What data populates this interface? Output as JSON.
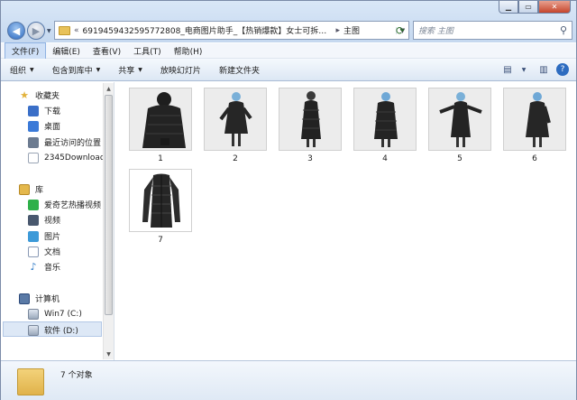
{
  "window": {
    "path_prefix": "«",
    "path_main": "6919459432595772808_电商图片助手_【热销爆款】女士可拆…",
    "path_last": "主图",
    "path_separator": "▸",
    "search_placeholder": "搜索 主图"
  },
  "menu": [
    "文件(F)",
    "编辑(E)",
    "查看(V)",
    "工具(T)",
    "帮助(H)"
  ],
  "toolbar": {
    "organize": "组织",
    "include_library": "包含到库中",
    "share": "共享",
    "slideshow": "放映幻灯片",
    "new_folder": "新建文件夹"
  },
  "sidebar": {
    "favorites": "收藏夹",
    "downloads": "下载",
    "desktop": "桌面",
    "recent": "最近访问的位置",
    "downloads2345": "2345Downloads",
    "libraries": "库",
    "iqiyi": "爱奇艺热播视频",
    "video": "视频",
    "pictures": "图片",
    "documents": "文档",
    "music": "音乐",
    "computer": "计算机",
    "drive_c": "Win7 (C:)",
    "drive_d": "软件 (D:)"
  },
  "files": [
    {
      "name": "1",
      "icon": "coat-photo-icon"
    },
    {
      "name": "2",
      "icon": "coat-photo-icon"
    },
    {
      "name": "3",
      "icon": "coat-photo-icon"
    },
    {
      "name": "4",
      "icon": "coat-photo-icon"
    },
    {
      "name": "5",
      "icon": "coat-photo-icon"
    },
    {
      "name": "6",
      "icon": "coat-photo-icon"
    },
    {
      "name": "7",
      "icon": "coat-product-icon"
    }
  ],
  "status": {
    "count": "7 个对象"
  },
  "colors": {
    "selection": "#dde8f6",
    "accent": "#3a6fc8"
  }
}
